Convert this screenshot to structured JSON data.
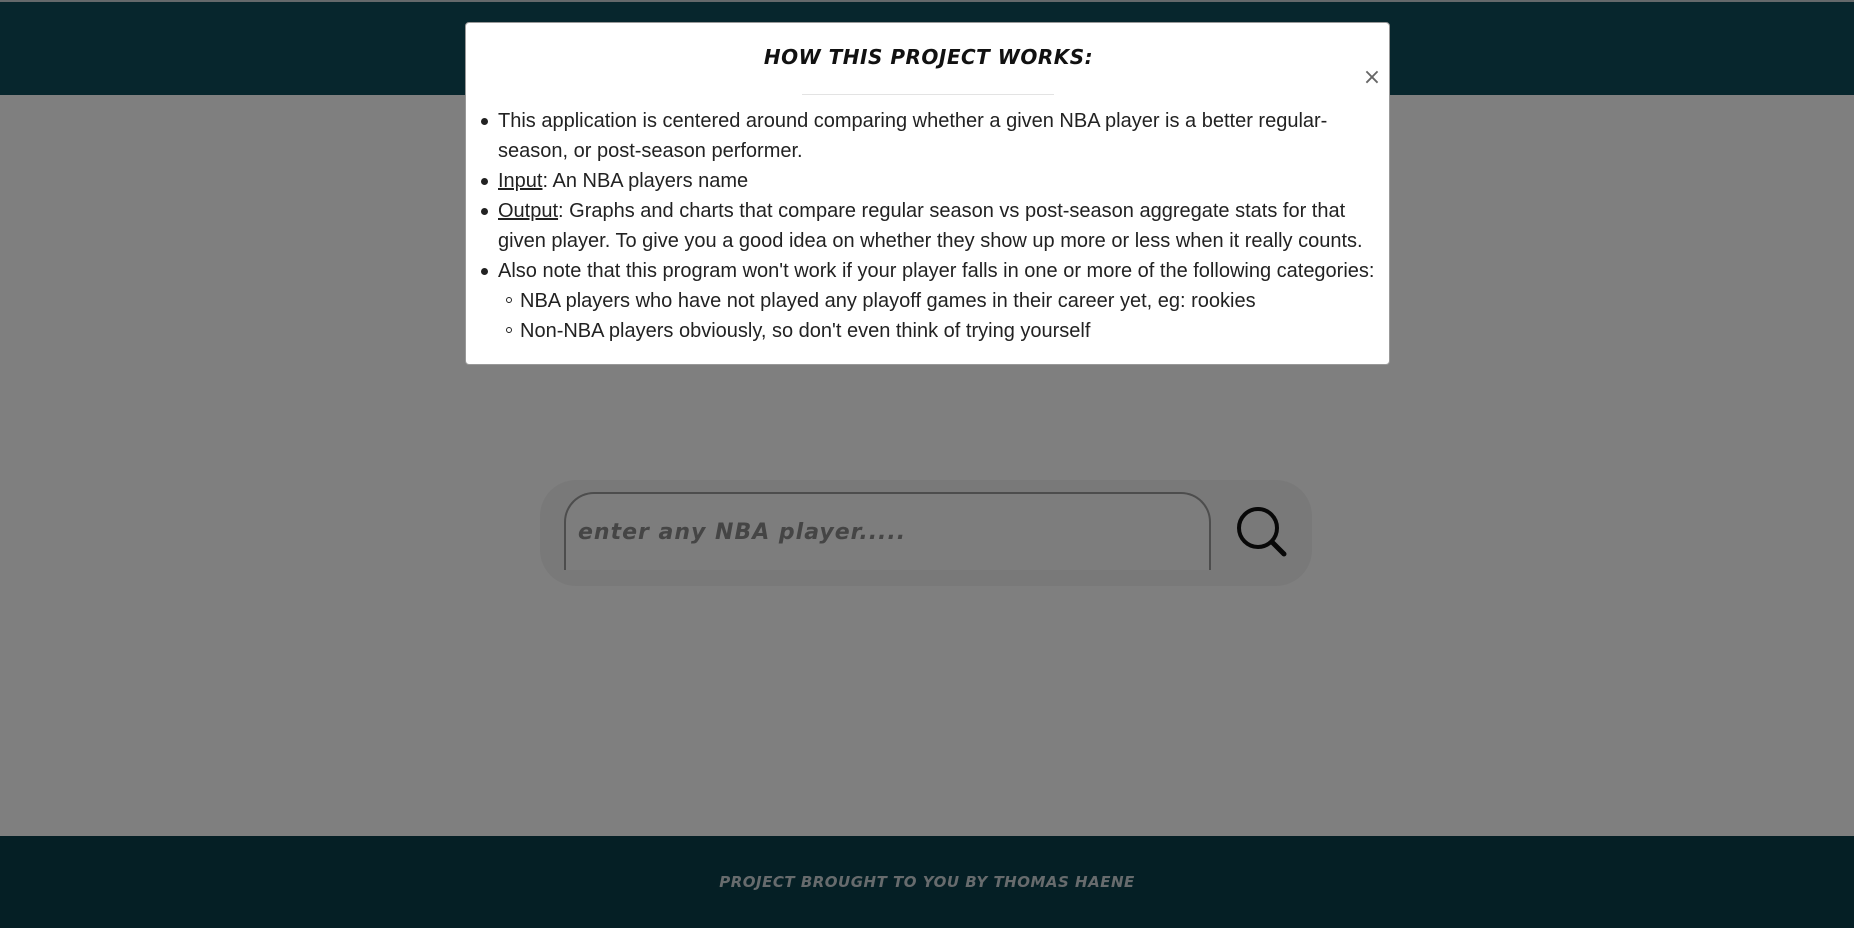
{
  "search": {
    "placeholder": "enter any NBA player....."
  },
  "footer": {
    "credit": "PROJECT BROUGHT TO YOU BY THOMAS HAENE"
  },
  "modal": {
    "title": "HOW THIS PROJECT WORKS:",
    "close_label": "×",
    "items": [
      {
        "text": "This application is centered around comparing whether a given NBA player is a better regular-season, or post-season performer."
      },
      {
        "label": "Input",
        "text": ": An NBA players name"
      },
      {
        "label": "Output",
        "text": ": Graphs and charts that compare regular season vs post-season aggregate stats for that given player. To give you a good idea on whether they show up more or less when it really counts."
      },
      {
        "text": "Also note that this program won't work if your player falls in one or more of the following categories:",
        "subitems": [
          "NBA players who have not played any playoff games in their career yet, eg: rookies",
          "Non-NBA players obviously, so don't even think of trying yourself"
        ]
      }
    ]
  },
  "icons": {
    "search_button": "search-icon",
    "close_button": "close-icon"
  },
  "colors": {
    "header_bg": "#0f4c5a",
    "footer_bg": "#0b3e4a",
    "overlay": "rgba(0,0,0,0.5)"
  }
}
